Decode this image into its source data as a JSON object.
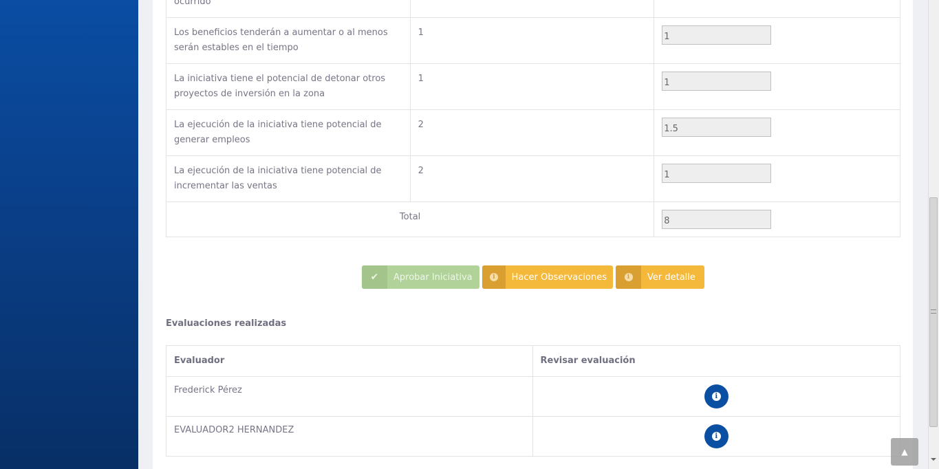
{
  "criteria": {
    "top_row_text": "ocurrido",
    "rows": [
      {
        "description": "Los beneficios tenderán a aumentar o al menos serán estables en el tiempo",
        "max": "1",
        "score": "1"
      },
      {
        "description": "La iniciativa tiene el potencial de detonar otros proyectos de inversión en la zona",
        "max": "1",
        "score": "1"
      },
      {
        "description": "La ejecución de la iniciativa tiene potencial de generar empleos",
        "max": "2",
        "score": "1.5"
      },
      {
        "description": "La ejecución de la iniciativa tiene potencial de incrementar las ventas",
        "max": "2",
        "score": "1"
      }
    ],
    "total_label": "Total",
    "total_value": "8"
  },
  "actions": {
    "approve_label": "Aprobar Iniciativa",
    "observations_label": "Hacer Observaciones",
    "detail_label": "Ver detalle"
  },
  "evaluations": {
    "title": "Evaluaciones realizadas",
    "headers": [
      "Evaluador",
      "Revisar evaluación"
    ],
    "rows": [
      {
        "evaluator": "Frederick Pérez"
      },
      {
        "evaluator": "EVALUADOR2 HERNANDEZ"
      }
    ]
  },
  "colors": {
    "sidebar_blue": "#0a4da3",
    "approve_green": "#b1d39a",
    "warning_yellow": "#f4b93a",
    "info_blue": "#0b4fa3"
  },
  "icons": {
    "approve": "check-icon",
    "observations": "info-icon",
    "detail": "info-icon",
    "review": "info-icon",
    "scroll_top": "chevron-up-icon"
  }
}
